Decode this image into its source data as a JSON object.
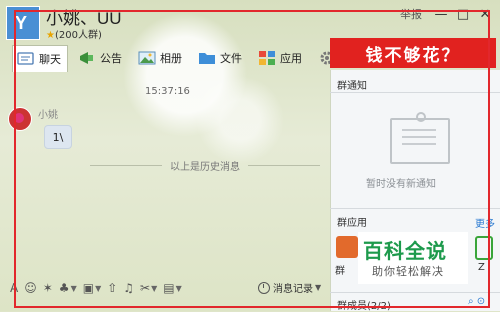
{
  "window": {
    "group_name": "小姚、UU",
    "member_count": "(200人群)",
    "report_label": "举报",
    "controls": [
      "—",
      "□",
      "✕"
    ]
  },
  "tabs": [
    {
      "label": "聊天",
      "icon": "chat-icon"
    },
    {
      "label": "公告",
      "icon": "announcement-icon"
    },
    {
      "label": "相册",
      "icon": "album-icon"
    },
    {
      "label": "文件",
      "icon": "folder-icon"
    },
    {
      "label": "应用",
      "icon": "apps-icon"
    }
  ],
  "ad_banner": "钱不够花？",
  "chat": {
    "timestamp": "15:37:16",
    "sender": "小姚",
    "message": "1\\",
    "history_divider": "以上是历史消息"
  },
  "panel": {
    "notice_title": "群通知",
    "notice_empty": "暂时没有新通知",
    "apps_title": "群应用",
    "more_link": "更多",
    "apps": [
      "群",
      "Z"
    ],
    "members_title": "群成员(2/2)"
  },
  "watermark": {
    "title": "百科全说",
    "subtitle": "助你轻松解决"
  },
  "toolbar": {
    "history_label": "消息记录"
  },
  "colors": {
    "frame": "#e2272c",
    "banner": "#e1221f",
    "link": "#2a7ad1",
    "watermark_green": "#1d9a4c"
  }
}
